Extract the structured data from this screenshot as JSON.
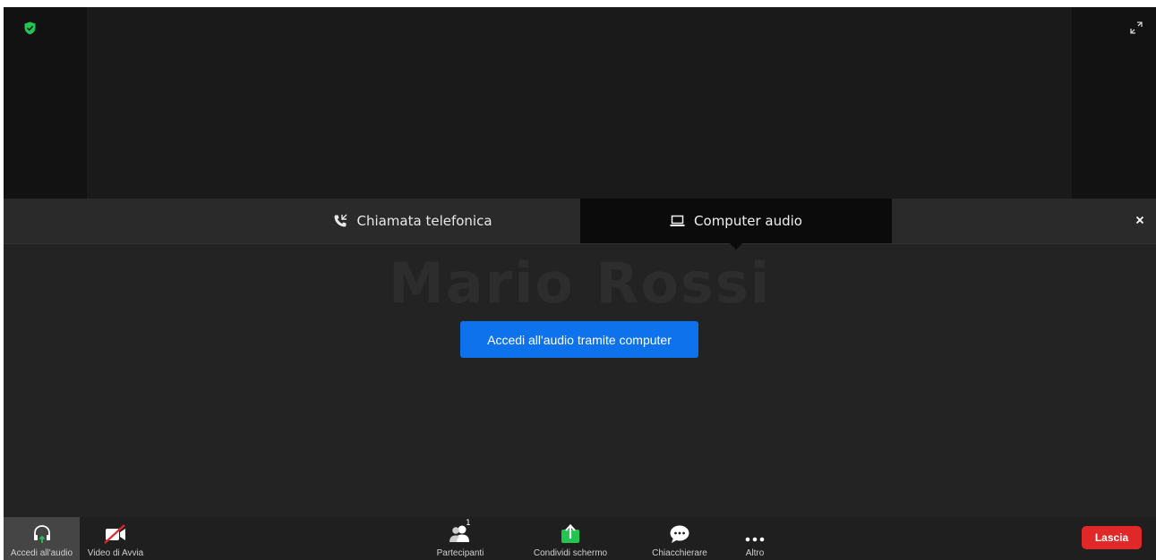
{
  "background_name": "Mario Rossi",
  "tabs": {
    "phone_label": "Chiamata telefonica",
    "computer_label": "Computer audio"
  },
  "join_button_label": "Accedi all'audio tramite computer",
  "toolbar": {
    "audio_label": "Accedi all'audio",
    "video_label": "Video di Avvia",
    "participants_label": "Partecipanti",
    "participants_count": "1",
    "share_label": "Condividi schermo",
    "chat_label": "Chiacchierare",
    "more_label": "Altro",
    "leave_label": "Lascia"
  },
  "icons": {
    "shield": "shield-check-icon",
    "expand": "expand-icon",
    "phone": "phone-icon",
    "computer": "laptop-icon",
    "close": "close-icon",
    "headphones": "headphones-icon",
    "video_off": "video-off-icon",
    "participants": "participants-icon",
    "share": "share-screen-icon",
    "chat": "chat-icon",
    "more": "more-icon"
  },
  "colors": {
    "accent_blue": "#0e72ed",
    "leave_red": "#e02828",
    "share_green": "#23c552",
    "shield_green": "#23c552"
  }
}
